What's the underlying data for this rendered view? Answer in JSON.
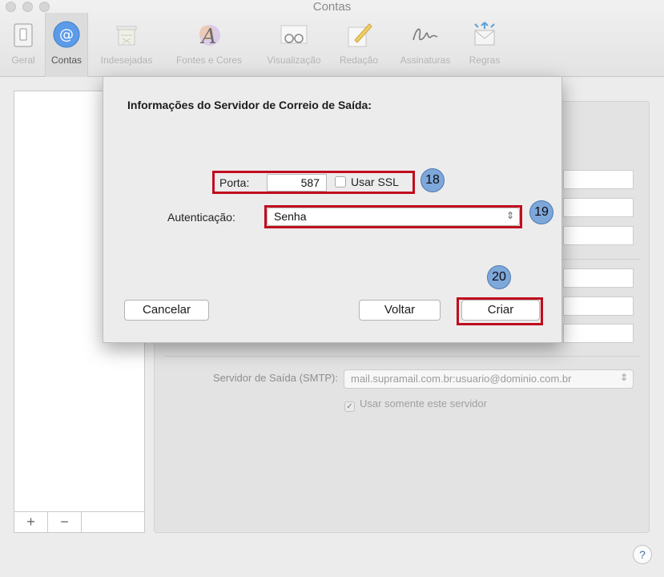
{
  "window": {
    "title": "Contas"
  },
  "toolbar": {
    "items": [
      {
        "label": "Geral",
        "icon": "switch-icon"
      },
      {
        "label": "Contas",
        "icon": "at-sign-icon"
      },
      {
        "label": "Indesejadas",
        "icon": "trash-icon"
      },
      {
        "label": "Fontes e Cores",
        "icon": "font-a-icon"
      },
      {
        "label": "Visualização",
        "icon": "glasses-icon"
      },
      {
        "label": "Redação",
        "icon": "pencil-icon"
      },
      {
        "label": "Assinaturas",
        "icon": "signature-icon"
      },
      {
        "label": "Regras",
        "icon": "rules-envelope-icon"
      }
    ],
    "active": "Contas"
  },
  "sheet": {
    "title": "Informações do Servidor de Correio de Saída:",
    "port_label": "Porta:",
    "port_value": "587",
    "ssl_label": "Usar SSL",
    "ssl_checked": false,
    "auth_label": "Autenticação:",
    "auth_value": "Senha",
    "cancel_label": "Cancelar",
    "back_label": "Voltar",
    "create_label": "Criar"
  },
  "annotations": {
    "badge_18": "18",
    "badge_19": "19",
    "badge_20": "20",
    "highlight_color": "#c00d1e",
    "badge_color": "#7ea7da"
  },
  "background": {
    "smtp_label": "Servidor de Saída (SMTP):",
    "smtp_value": "mail.supramail.com.br:usuario@dominio.com.br",
    "only_server_label": "Usar somente este servidor",
    "only_server_checked": true,
    "add_symbol": "+",
    "remove_symbol": "−",
    "help_symbol": "?"
  }
}
